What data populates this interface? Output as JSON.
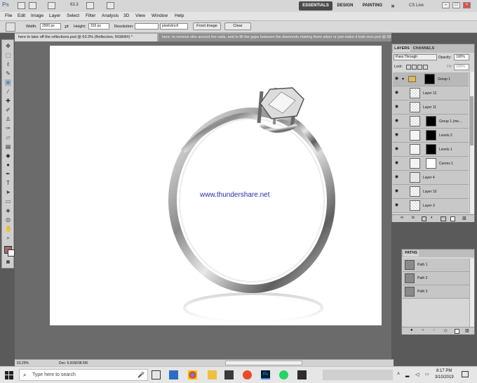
{
  "appbar": {
    "logo": "Ps",
    "zoom": "63.3",
    "workspaces": [
      "ESSENTIALS",
      "DESIGN",
      "PAINTING"
    ],
    "more": "»",
    "cslive": "CS Live",
    "window_buttons": [
      "–",
      "□",
      "×"
    ]
  },
  "menu": [
    "File",
    "Edit",
    "Image",
    "Layer",
    "Select",
    "Filter",
    "Analysis",
    "3D",
    "View",
    "Window",
    "Help"
  ],
  "options": {
    "width_label": "Width:",
    "width_value": "2500 px",
    "height_label": "Height:",
    "height_value": "315 px",
    "resolution_label": "Resolution:",
    "resolution_value": "",
    "resolution_unit": "pixels/inch",
    "front_image": "Front Image",
    "clear": "Clear"
  },
  "tabs": {
    "tab1": "here to take off the reflections.psd @ 63.3% (Reflection, RGB/8#) *",
    "tab2": "here, to remove skin around the nails, and to fill the gaps between the diamonds making them silver or just make it look nice.psd @ 50% (Group 2,..."
  },
  "canvas": {
    "watermark": "www.thundershare.net"
  },
  "status": {
    "zoom": "63.29%",
    "doc": "Doc: 6.81M/38.5M"
  },
  "layers_panel": {
    "tabs": [
      "LAYERS",
      "CHANNELS"
    ],
    "blend_mode": "Pass Through",
    "opacity_label": "Opacity:",
    "opacity_value": "100%",
    "lock_label": "Lock:",
    "fill_label": "Fill:",
    "fill_value": "100%",
    "layers": [
      {
        "name": "Group 1",
        "kind": "group"
      },
      {
        "name": "Layer 12",
        "kind": "layer"
      },
      {
        "name": "Layer 11",
        "kind": "layer"
      },
      {
        "name": "Group 1 (me...",
        "kind": "masked"
      },
      {
        "name": "Levels 2",
        "kind": "levels"
      },
      {
        "name": "Levels 1",
        "kind": "levels"
      },
      {
        "name": "Curves 1",
        "kind": "curves"
      },
      {
        "name": "Layer 4",
        "kind": "layer"
      },
      {
        "name": "Layer 10",
        "kind": "layer"
      },
      {
        "name": "Layer 3",
        "kind": "layer"
      }
    ],
    "footer_icons": [
      "link-icon",
      "fx-icon",
      "mask-icon",
      "adjustment-icon",
      "folder-icon",
      "new-layer-icon",
      "trash-icon"
    ]
  },
  "paths_panel": {
    "title": "PATHS",
    "paths": [
      "Path 1",
      "Path 2",
      "Path 3"
    ]
  },
  "taskbar": {
    "search_placeholder": "Type here to search",
    "time": "8:17 PM",
    "date": "3/10/2019"
  },
  "colors": {
    "foreground": "#a46a6a",
    "background": "#ffffff",
    "watermark": "#2a2aa8"
  }
}
